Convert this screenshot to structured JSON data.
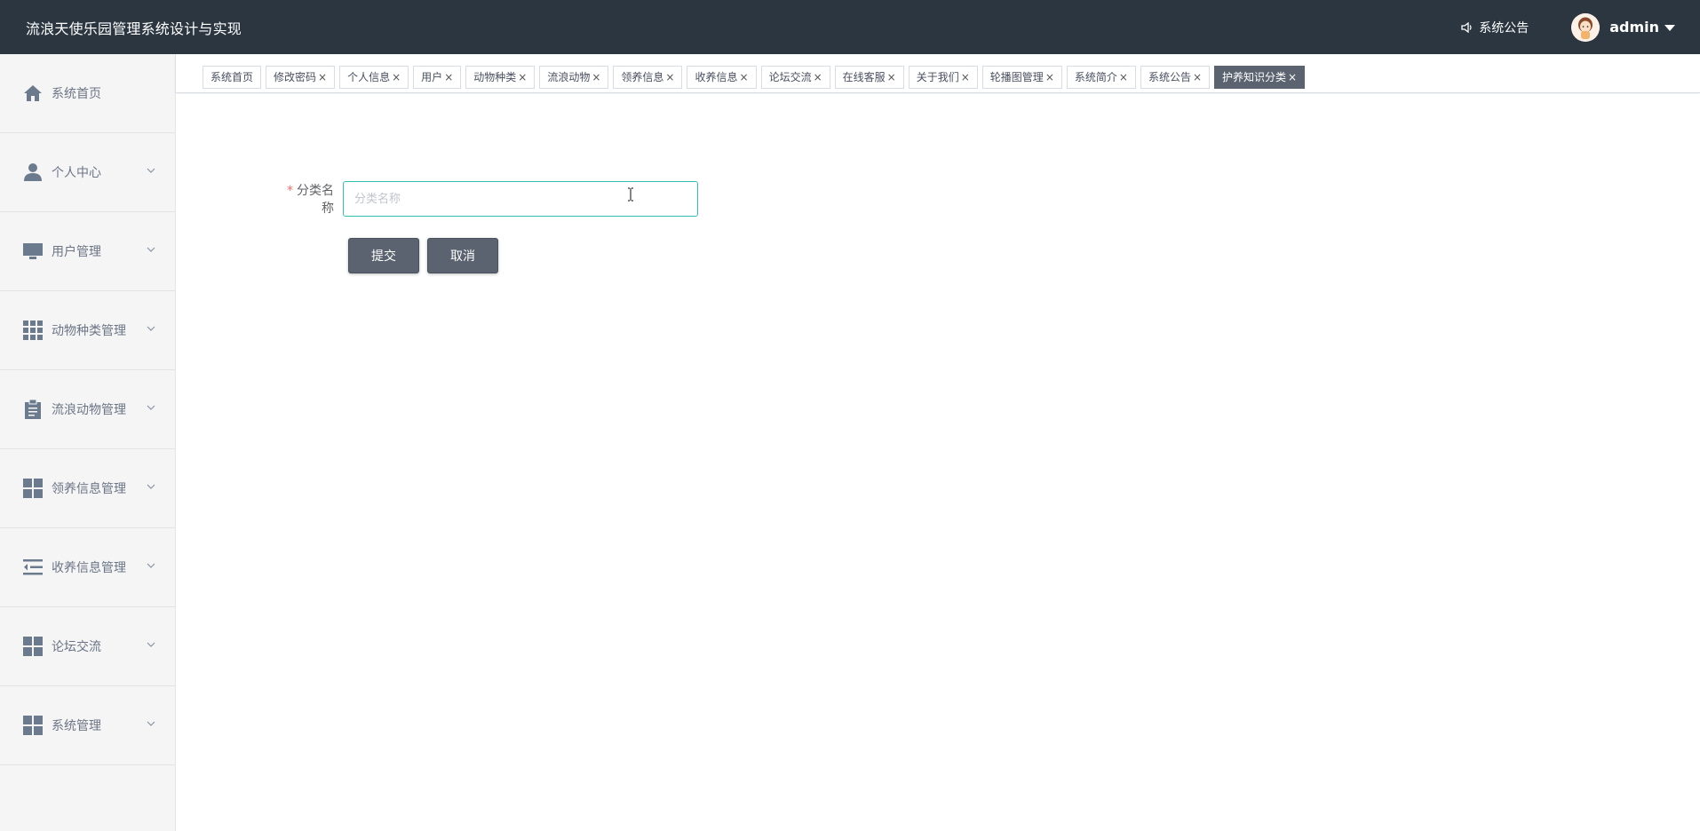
{
  "header": {
    "title": "流浪天使乐园管理系统设计与实现",
    "notice_label": "系统公告",
    "username": "admin"
  },
  "sidebar": {
    "items": [
      {
        "label": "系统首页",
        "icon": "home-icon"
      },
      {
        "label": "个人中心",
        "icon": "person-icon"
      },
      {
        "label": "用户管理",
        "icon": "monitor-icon"
      },
      {
        "label": "动物种类管理",
        "icon": "grid-icon"
      },
      {
        "label": "流浪动物管理",
        "icon": "clipboard-icon"
      },
      {
        "label": "领养信息管理",
        "icon": "dashboard-icon"
      },
      {
        "label": "收养信息管理",
        "icon": "list-indent-icon"
      },
      {
        "label": "论坛交流",
        "icon": "dashboard-icon"
      },
      {
        "label": "系统管理",
        "icon": "dashboard-icon"
      }
    ]
  },
  "tabs": [
    {
      "label": "系统首页",
      "closable": false
    },
    {
      "label": "修改密码",
      "closable": true
    },
    {
      "label": "个人信息",
      "closable": true
    },
    {
      "label": "用户",
      "closable": true
    },
    {
      "label": "动物种类",
      "closable": true
    },
    {
      "label": "流浪动物",
      "closable": true
    },
    {
      "label": "领养信息",
      "closable": true
    },
    {
      "label": "收养信息",
      "closable": true
    },
    {
      "label": "论坛交流",
      "closable": true
    },
    {
      "label": "在线客服",
      "closable": true
    },
    {
      "label": "关于我们",
      "closable": true
    },
    {
      "label": "轮播图管理",
      "closable": true
    },
    {
      "label": "系统简介",
      "closable": true
    },
    {
      "label": "系统公告",
      "closable": true
    },
    {
      "label": "护养知识分类",
      "closable": true,
      "active": true
    }
  ],
  "form": {
    "required_mark": "*",
    "category_label": "分类名称",
    "category_placeholder": "分类名称",
    "category_value": "",
    "submit_label": "提交",
    "cancel_label": "取消"
  },
  "colors": {
    "header_bg": "#2b3641",
    "sidebar_bg": "#f5f5f5",
    "active_tab": "#5a636f",
    "button_bg": "#5a636f",
    "input_focus_border": "#2ebfb0",
    "required": "#f56c6c"
  }
}
